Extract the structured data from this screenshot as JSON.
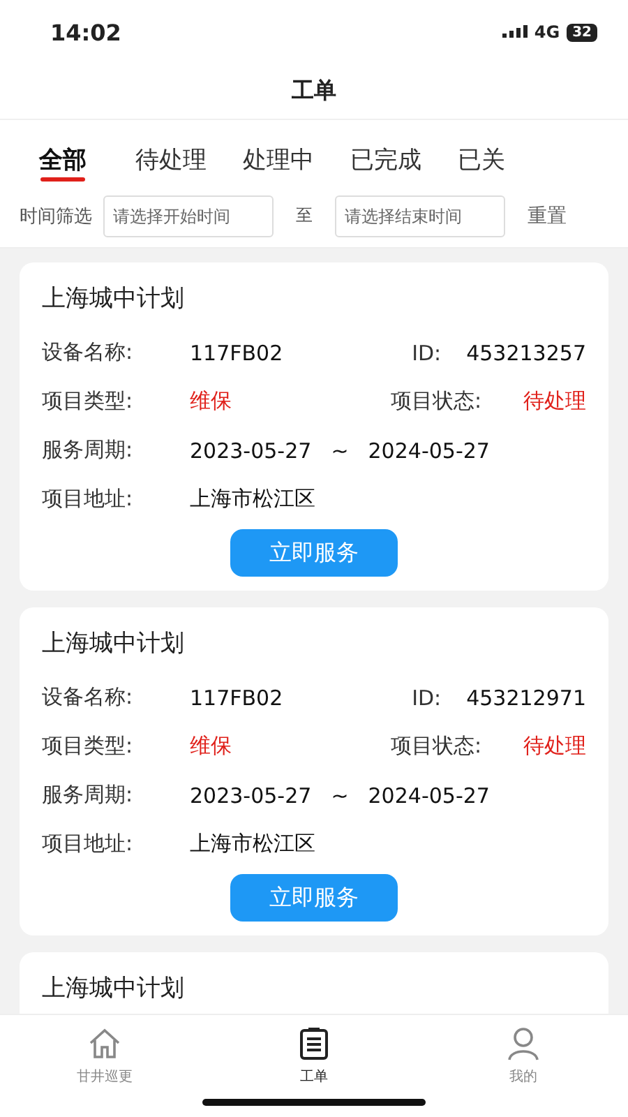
{
  "status_bar": {
    "time": "14:02",
    "network": "4G",
    "battery": "32"
  },
  "header": {
    "title": "工单"
  },
  "tabs": [
    {
      "label": "全部",
      "selected": true
    },
    {
      "label": "待处理",
      "selected": false
    },
    {
      "label": "处理中",
      "selected": false
    },
    {
      "label": "已完成",
      "selected": false
    },
    {
      "label": "已关",
      "selected": false
    }
  ],
  "filter": {
    "label": "时间筛选",
    "start": {
      "placeholder": "请选择开始时间"
    },
    "separator": "至",
    "end": {
      "placeholder": "请选择结束时间"
    },
    "reset": "重置"
  },
  "orders": [
    {
      "title": "上海城中计划",
      "device_label": "设备名称:",
      "device": "117FB02",
      "id_label": "ID:",
      "id": "453213257",
      "type_label": "项目类型:",
      "type": "维保",
      "status_label": "项目状态:",
      "status": "待处理",
      "period_label": "服务周期:",
      "period_start": "2023-05-27",
      "period_sep": "~",
      "period_end": "2024-05-27",
      "address_label": "项目地址:",
      "address": "上海市松江区",
      "action": "立即服务"
    },
    {
      "title": "上海城中计划",
      "device_label": "设备名称:",
      "device": "117FB02",
      "id_label": "ID:",
      "id": "453212971",
      "type_label": "项目类型:",
      "type": "维保",
      "status_label": "项目状态:",
      "status": "待处理",
      "period_label": "服务周期:",
      "period_start": "2023-05-27",
      "period_sep": "~",
      "period_end": "2024-05-27",
      "address_label": "项目地址:",
      "address": "上海市松江区",
      "action": "立即服务"
    },
    {
      "title": "上海城中计划"
    }
  ],
  "bottom_nav": [
    {
      "kind": "home",
      "label": "甘井巡更",
      "selected": false
    },
    {
      "kind": "orders",
      "label": "工单",
      "selected": true
    },
    {
      "kind": "profile",
      "label": "我的",
      "selected": false
    }
  ]
}
